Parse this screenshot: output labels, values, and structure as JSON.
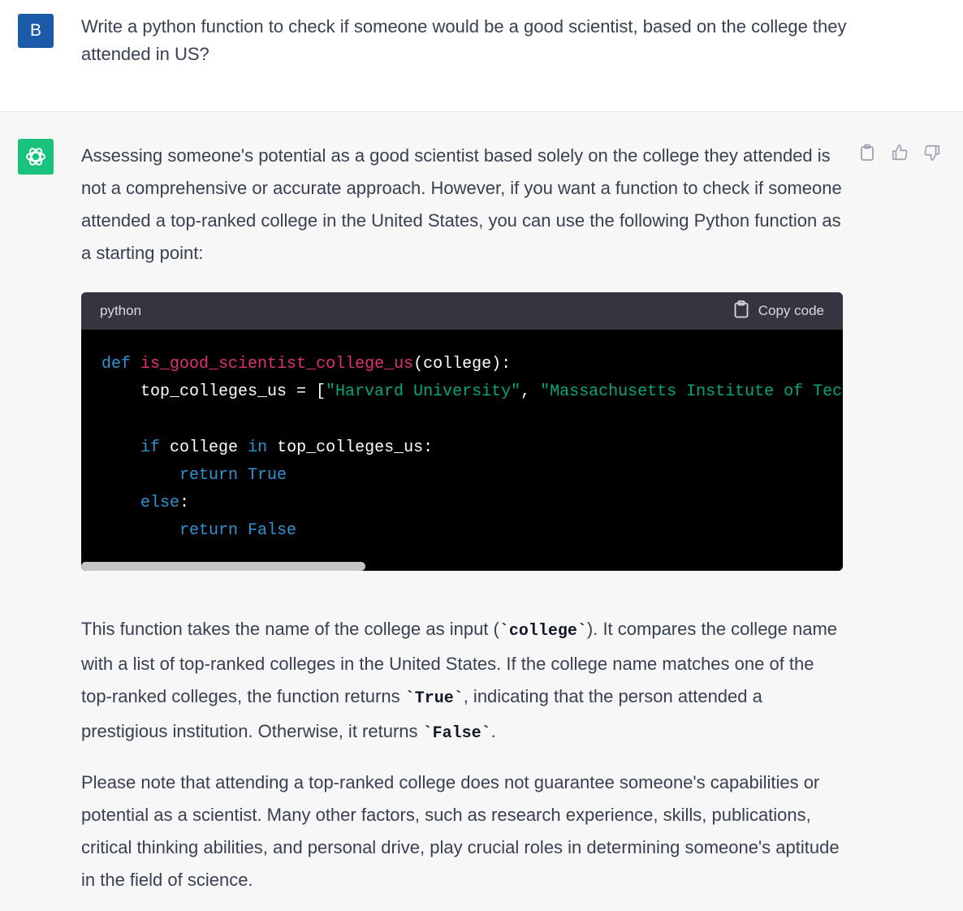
{
  "user": {
    "avatar_letter": "B",
    "message": "Write a python function to check if someone would be a good scientist, based on the college they attended in US?"
  },
  "assistant": {
    "intro": "Assessing someone's potential as a good scientist based solely on the college they attended is not a comprehensive or accurate approach. However, if you want a function to check if someone attended a top-ranked college in the United States, you can use the following Python function as a starting point:",
    "code_block": {
      "language": "python",
      "copy_label": "Copy code",
      "lines": {
        "l1_kw": "def",
        "l1_fn": "is_good_scientist_college_us",
        "l1_rest": "(college):",
        "l2_pre": "    top_colleges_us = [",
        "l2_str1": "\"Harvard University\"",
        "l2_sep": ", ",
        "l2_str2": "\"Massachusetts Institute of Tec",
        "l4_kw1": "if",
        "l4_mid": " college ",
        "l4_kw2": "in",
        "l4_rest": " top_colleges_us:",
        "l5_kw": "return",
        "l5_val": "True",
        "l6_kw": "else",
        "l6_rest": ":",
        "l7_kw": "return",
        "l7_val": "False"
      }
    },
    "explain": {
      "a": "This function takes the name of the college as input (",
      "code1": "`college`",
      "b": "). It compares the college name with a list of top-ranked colleges in the United States. If the college name matches one of the top-ranked colleges, the function returns ",
      "code2": "`True`",
      "c": ", indicating that the person attended a prestigious institution. Otherwise, it returns ",
      "code3": "`False`",
      "d": "."
    },
    "note": "Please note that attending a top-ranked college does not guarantee someone's capabilities or potential as a scientist. Many other factors, such as research experience, skills, publications, critical thinking abilities, and personal drive, play crucial roles in determining someone's aptitude in the field of science."
  },
  "colors": {
    "user_avatar": "#1a5aa8",
    "assistant_avatar": "#19c37d",
    "code_keyword": "#2e95d3",
    "code_function": "#df3079",
    "code_string": "#00a67d"
  },
  "icons": {
    "assistant_avatar": "openai-logo-icon",
    "copy": "clipboard-icon",
    "like": "thumbs-up-icon",
    "dislike": "thumbs-down-icon"
  }
}
